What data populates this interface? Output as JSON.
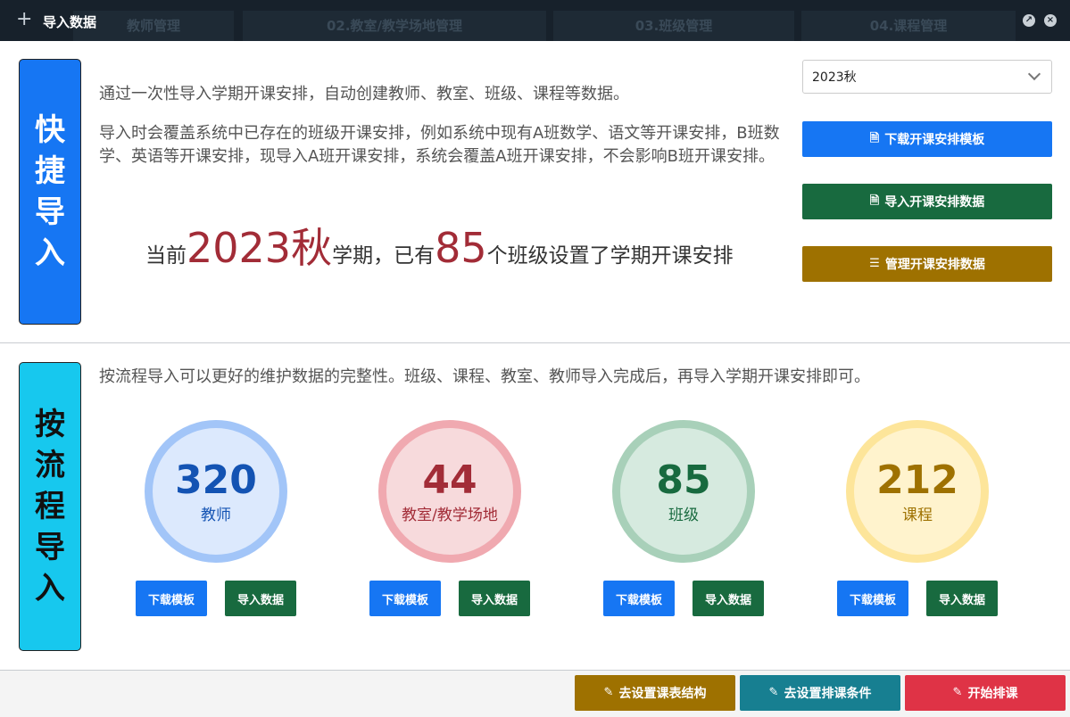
{
  "window": {
    "title": "导入数据",
    "bg_steps": [
      "教师管理",
      "02.教室/教学场地管理",
      "03.班级管理",
      "04.课程管理"
    ]
  },
  "quick": {
    "label_chars": [
      "快",
      "捷",
      "导",
      "入"
    ],
    "intro1": "通过一次性导入学期开课安排，自动创建教师、教室、班级、课程等数据。",
    "intro2": "导入时会覆盖系统中已存在的班级开课安排，例如系统中现有A班数学、语文等开课安排，B班数学、英语等开课安排，现导入A班开课安排，系统会覆盖A班开课安排，不会影响B班开课安排。",
    "stat": {
      "prefix": "当前",
      "semester": "2023秋",
      "mid": "学期，已有",
      "count": "85",
      "suffix": "个班级设置了学期开课安排"
    },
    "semester_select": "2023秋",
    "buttons": {
      "download_template": "下载开课安排模板",
      "import_data": "导入开课安排数据",
      "manage_data": "管理开课安排数据"
    }
  },
  "flow": {
    "label_chars": [
      "按",
      "流",
      "程",
      "导",
      "入"
    ],
    "intro": "按流程导入可以更好的维护数据的完整性。班级、课程、教室、教师导入完成后，再导入学期开课安排即可。",
    "items": [
      {
        "count": "320",
        "label": "教师",
        "download": "下载模板",
        "import": "导入数据"
      },
      {
        "count": "44",
        "label": "教室/教学场地",
        "download": "下载模板",
        "import": "导入数据"
      },
      {
        "count": "85",
        "label": "班级",
        "download": "下载模板",
        "import": "导入数据"
      },
      {
        "count": "212",
        "label": "课程",
        "download": "下载模板",
        "import": "导入数据"
      }
    ]
  },
  "footer": {
    "set_structure": "去设置课表结构",
    "set_conditions": "去设置排课条件",
    "start": "开始排课"
  },
  "colors": {
    "blue": "#1676f3",
    "green": "#186a3f",
    "gold": "#9e7100",
    "teal": "#177f91",
    "red": "#df3346",
    "cyan": "#17c8ee",
    "accent_text": "#a22c37"
  }
}
